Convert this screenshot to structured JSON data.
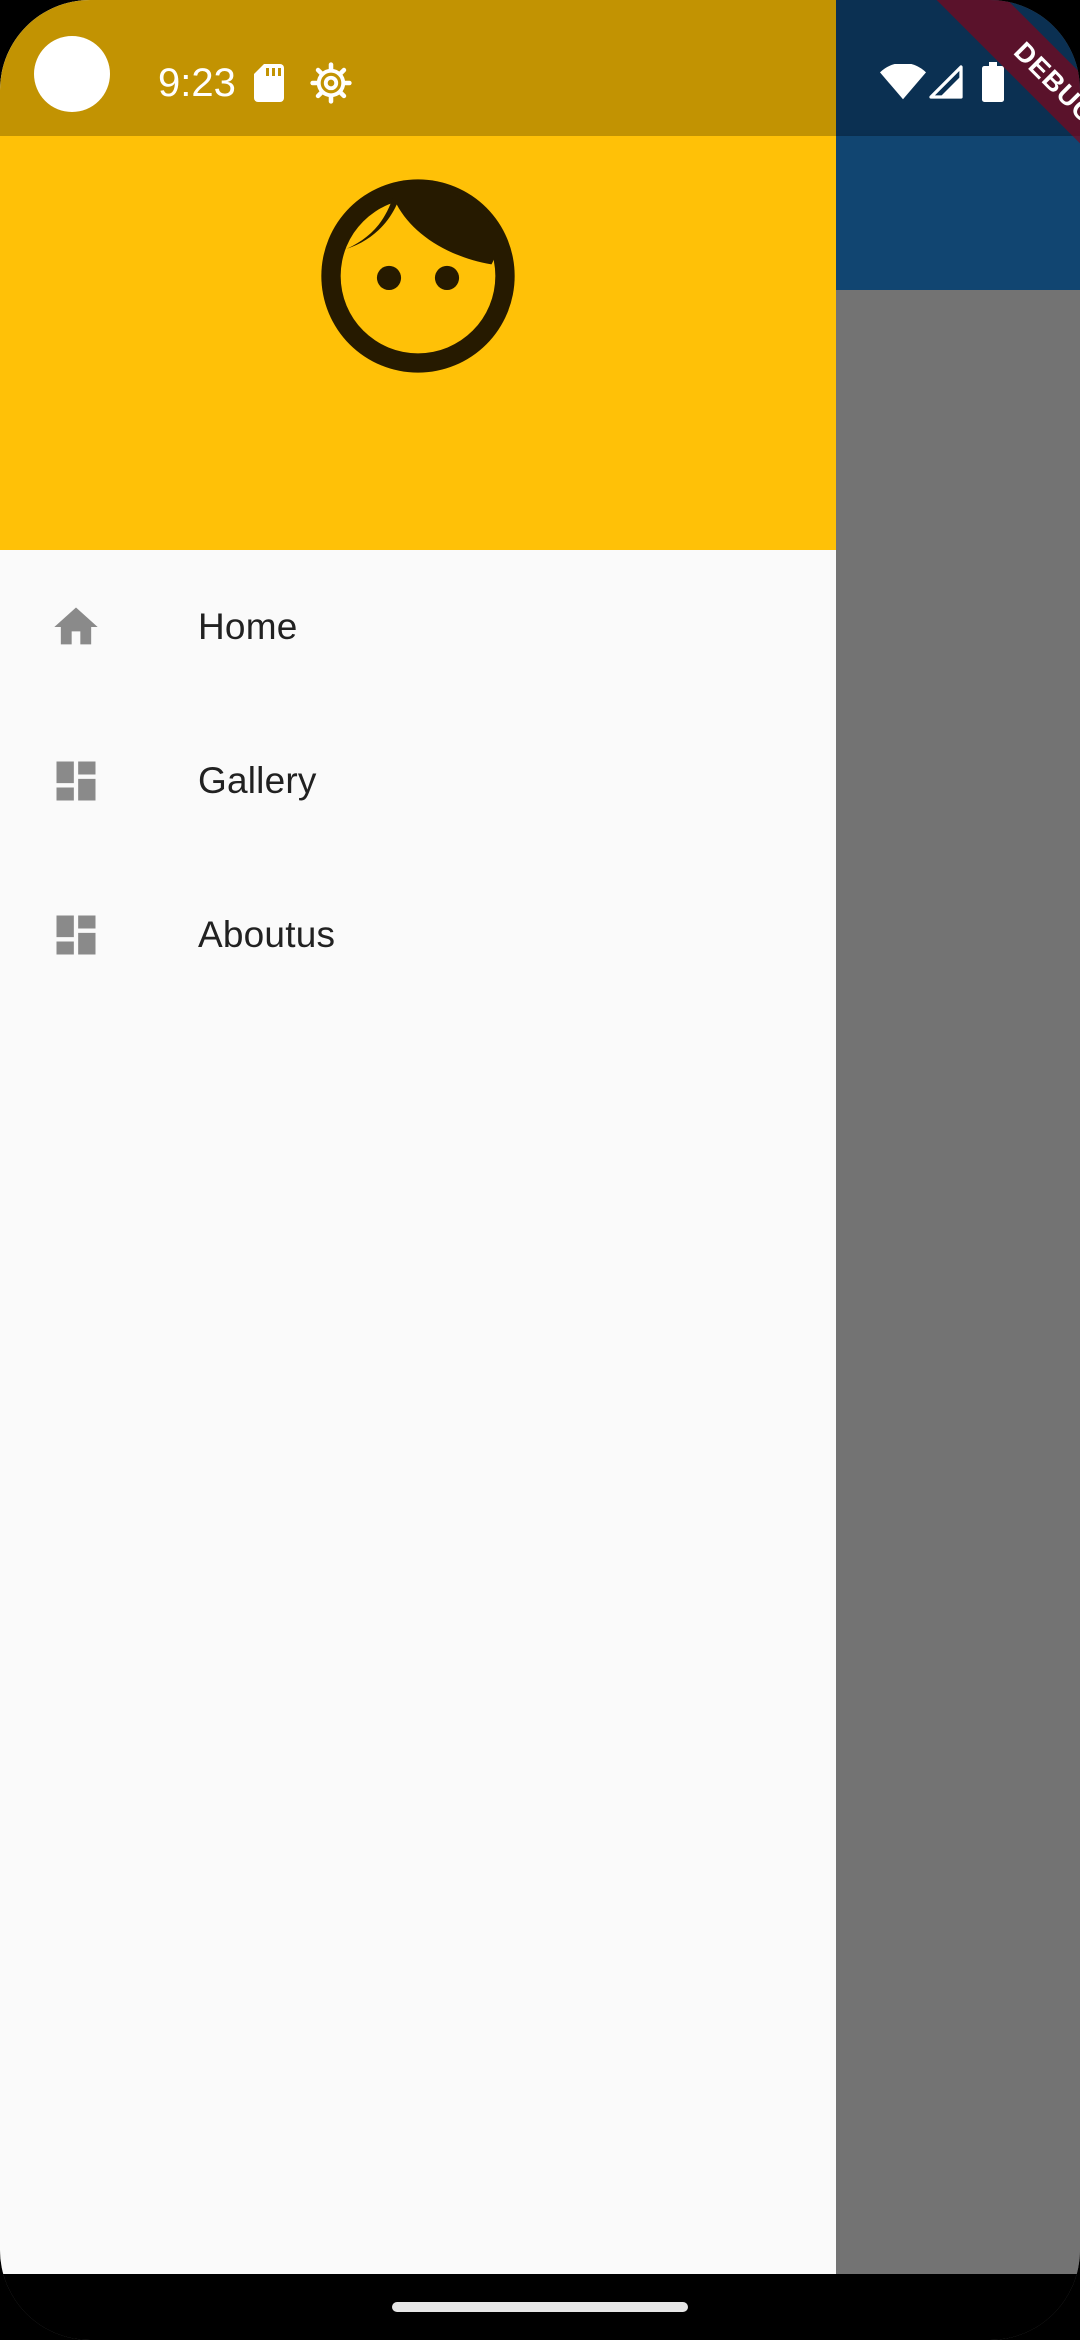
{
  "status_bar": {
    "time": "9:23",
    "icons": [
      "sd-card-icon",
      "gear-icon",
      "wifi-icon",
      "signal-icon",
      "battery-icon"
    ]
  },
  "debug_banner": {
    "label": "DEBUG"
  },
  "drawer": {
    "header": {
      "avatar_icon": "face-icon"
    },
    "items": [
      {
        "icon": "home-icon",
        "label": "Home"
      },
      {
        "icon": "dashboard-icon",
        "label": "Gallery"
      },
      {
        "icon": "dashboard-icon",
        "label": "Aboutus"
      }
    ]
  },
  "colors": {
    "drawer_header": "#ffc107",
    "drawer_status": "#c29302",
    "app_bar": "#114571",
    "scrim": "#737373",
    "icon_gray": "#8a8a8a",
    "text": "#212121"
  }
}
